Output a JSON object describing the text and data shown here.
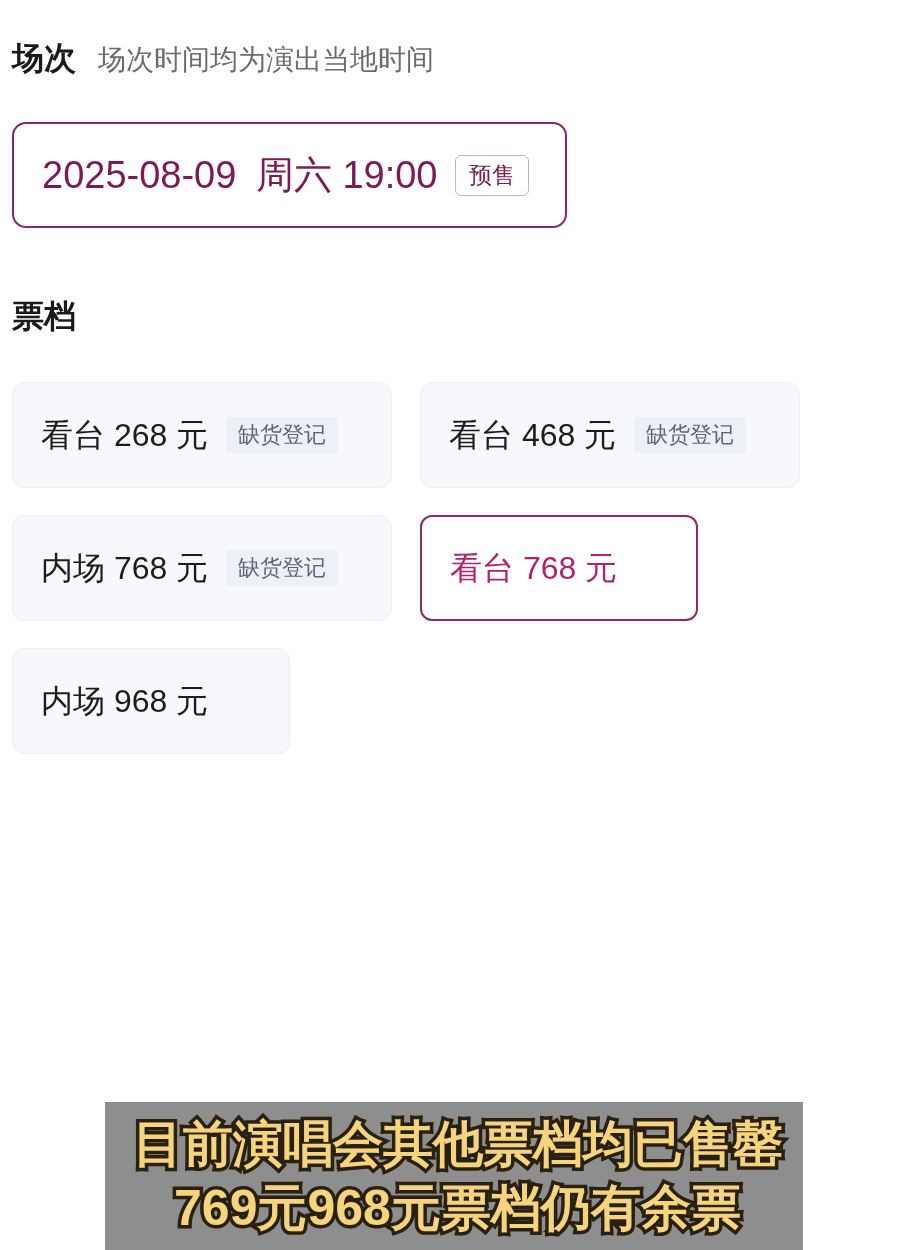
{
  "session": {
    "title": "场次",
    "note": "场次时间均为演出当地时间",
    "options": [
      {
        "date": "2025-08-09",
        "weekday": "周六",
        "time": "19:00",
        "badge": "预售",
        "selected": true
      }
    ]
  },
  "tiers": {
    "title": "票档",
    "items": [
      {
        "label": "看台 268 元",
        "badge": "缺货登记",
        "selected": false
      },
      {
        "label": "看台 468 元",
        "badge": "缺货登记",
        "selected": false
      },
      {
        "label": "内场 768 元",
        "badge": "缺货登记",
        "selected": false
      },
      {
        "label": "看台 768 元",
        "selected": true
      },
      {
        "label": "内场 968 元",
        "selected": false
      }
    ]
  },
  "caption": {
    "lines": [
      "目前演唱会其他票档均已售罄",
      "769元968元票档仍有余票"
    ]
  }
}
